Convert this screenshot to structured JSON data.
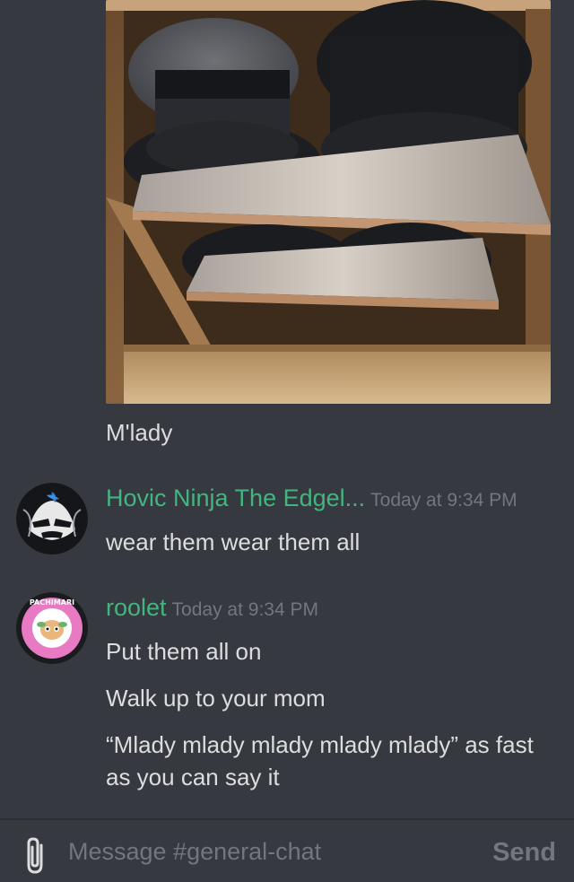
{
  "colors": {
    "background": "#36393f",
    "username": "#43b581",
    "text": "#dcddde",
    "muted": "#72767d"
  },
  "attachment": {
    "alt": "Photo of black and grey fedora hats stacked on metal closet shelves"
  },
  "caption": "M'lady",
  "messages": [
    {
      "avatar_icon": "ninja-avatar-icon",
      "username": "Hovic Ninja The Edgel...",
      "timestamp": "Today at 9:34 PM",
      "lines": [
        "wear them wear them all"
      ]
    },
    {
      "avatar_icon": "pachimari-avatar-icon",
      "avatar_text": "PACHIMARI",
      "username": "roolet",
      "timestamp": "Today at 9:34 PM",
      "lines": [
        "Put them all on",
        "Walk up to your mom",
        "“Mlady mlady mlady mlady mlady” as fast as you can say it"
      ]
    }
  ],
  "composer": {
    "attach_icon": "paperclip-icon",
    "placeholder": "Message #general-chat",
    "send_label": "Send"
  }
}
